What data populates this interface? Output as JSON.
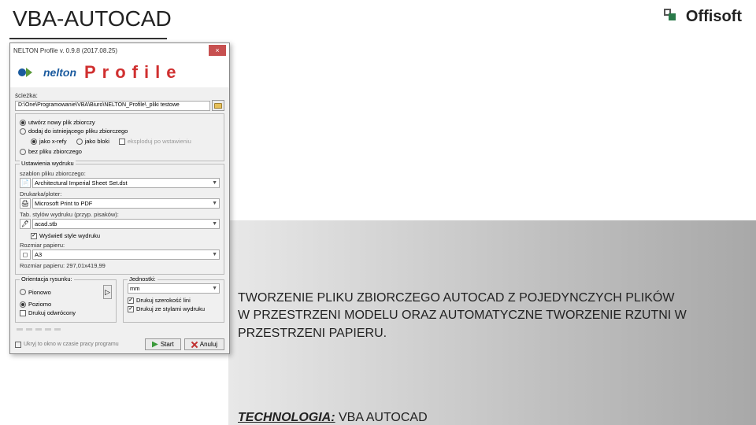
{
  "slide": {
    "title": "VBA-AUTOCAD"
  },
  "logo": {
    "text": "Offisoft"
  },
  "dialog": {
    "title": "NELTON Profile v. 0.9.8 (2017.08.25)",
    "header": {
      "brand": "nelton",
      "word": "Profile"
    },
    "path": {
      "label": "ścieżka:",
      "value": "D:\\One\\Programowanie\\VBA\\Biuro\\NELTON_Profile\\_pliki testowe"
    },
    "opts": {
      "r_new": "utwórz nowy plik zbiorczy",
      "r_append": "dodaj do istniejącego pliku zbiorczego",
      "r_xref": "jako x-refy",
      "r_block": "jako bloki",
      "c_explode": "eksploduj po wstawieniu",
      "c_nofile": "bez pliku  zbiorczego"
    },
    "print": {
      "group": "Ustawienia wydruku",
      "template_label": "szablon pliku zbiorczego:",
      "template": "Architectural Imperial Sheet Set.dst",
      "printer_label": "Drukarka/ploter:",
      "printer": "Microsoft Print to PDF",
      "penstyle_label": "Tab. stylów wydruku (przyp. pisaków):",
      "penstyle": "acad.stb",
      "c_showstyle": "Wyświetl style wydruku",
      "size_label": "Rozmiar papieru:",
      "size": "A3",
      "dims_label": "Rozmiar papieru: 297,01x419,99"
    },
    "orient": {
      "group": "Orientacja rysunku:",
      "r_portrait": "Pionowo",
      "r_landscape": "Poziomo",
      "c_rev": "Drukuj odwrócony",
      "units_label": "Jednostki:",
      "units": "mm",
      "c_linew": "Drukuj szerokość lini",
      "c_pstyle": "Drukuj ze stylami wydruku"
    },
    "footer": {
      "c_hide": "Ukryj to okno w czasie pracy programu",
      "start": "Start",
      "cancel": "Anuluj"
    }
  },
  "description": {
    "line1": "TWORZENIE PLIKU ZBIORCZEGO AUTOCAD Z POJEDYNCZYCH PLIKÓW",
    "line2": "W PRZESTRZENI MODELU ORAZ AUTOMATYCZNE TWORZENIE RZUTNI W PRZESTRZENI PAPIERU."
  },
  "tech": {
    "label": "TECHNOLOGIA:",
    "value": " VBA AUTOCAD"
  }
}
